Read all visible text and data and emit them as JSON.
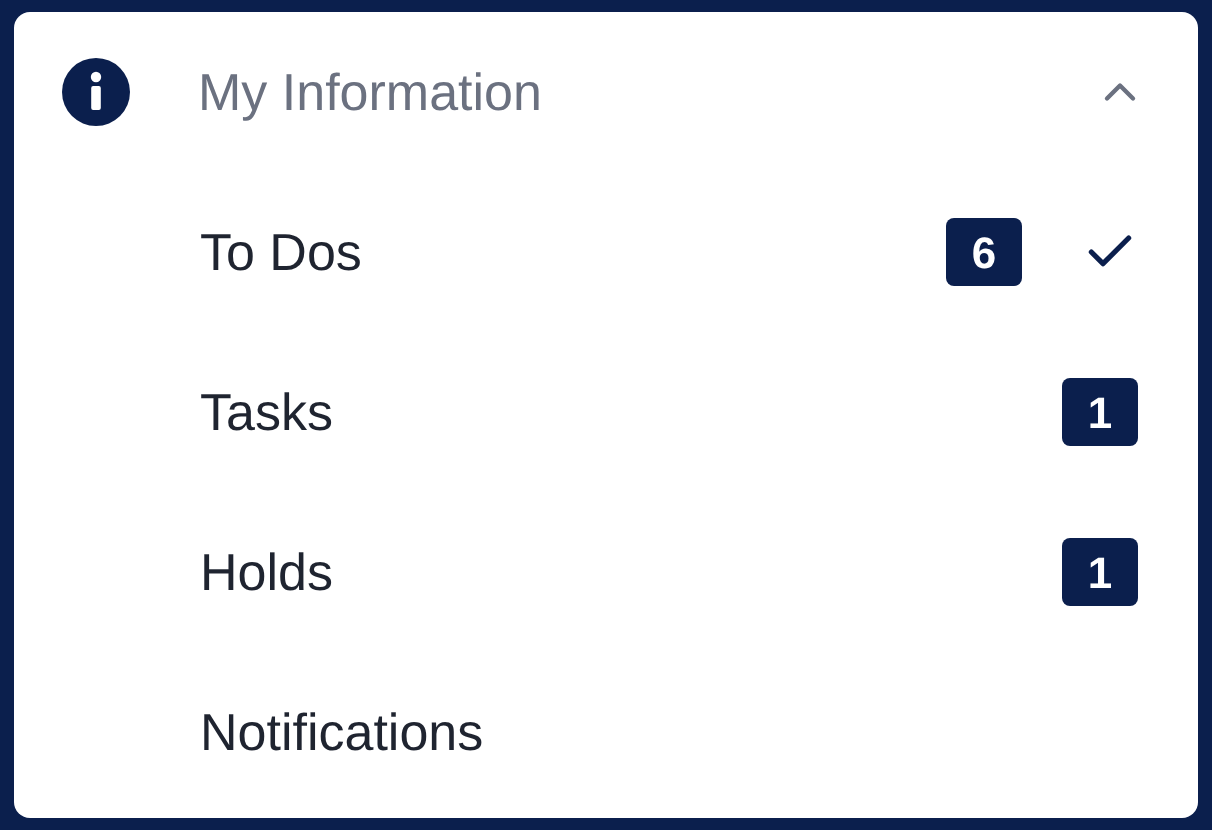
{
  "section": {
    "title": "My Information",
    "expanded": true
  },
  "items": [
    {
      "label": "To Dos",
      "badge": "6",
      "selected": true
    },
    {
      "label": "Tasks",
      "badge": "1",
      "selected": false
    },
    {
      "label": "Holds",
      "badge": "1",
      "selected": false
    },
    {
      "label": "Notifications",
      "selected": false
    }
  ]
}
